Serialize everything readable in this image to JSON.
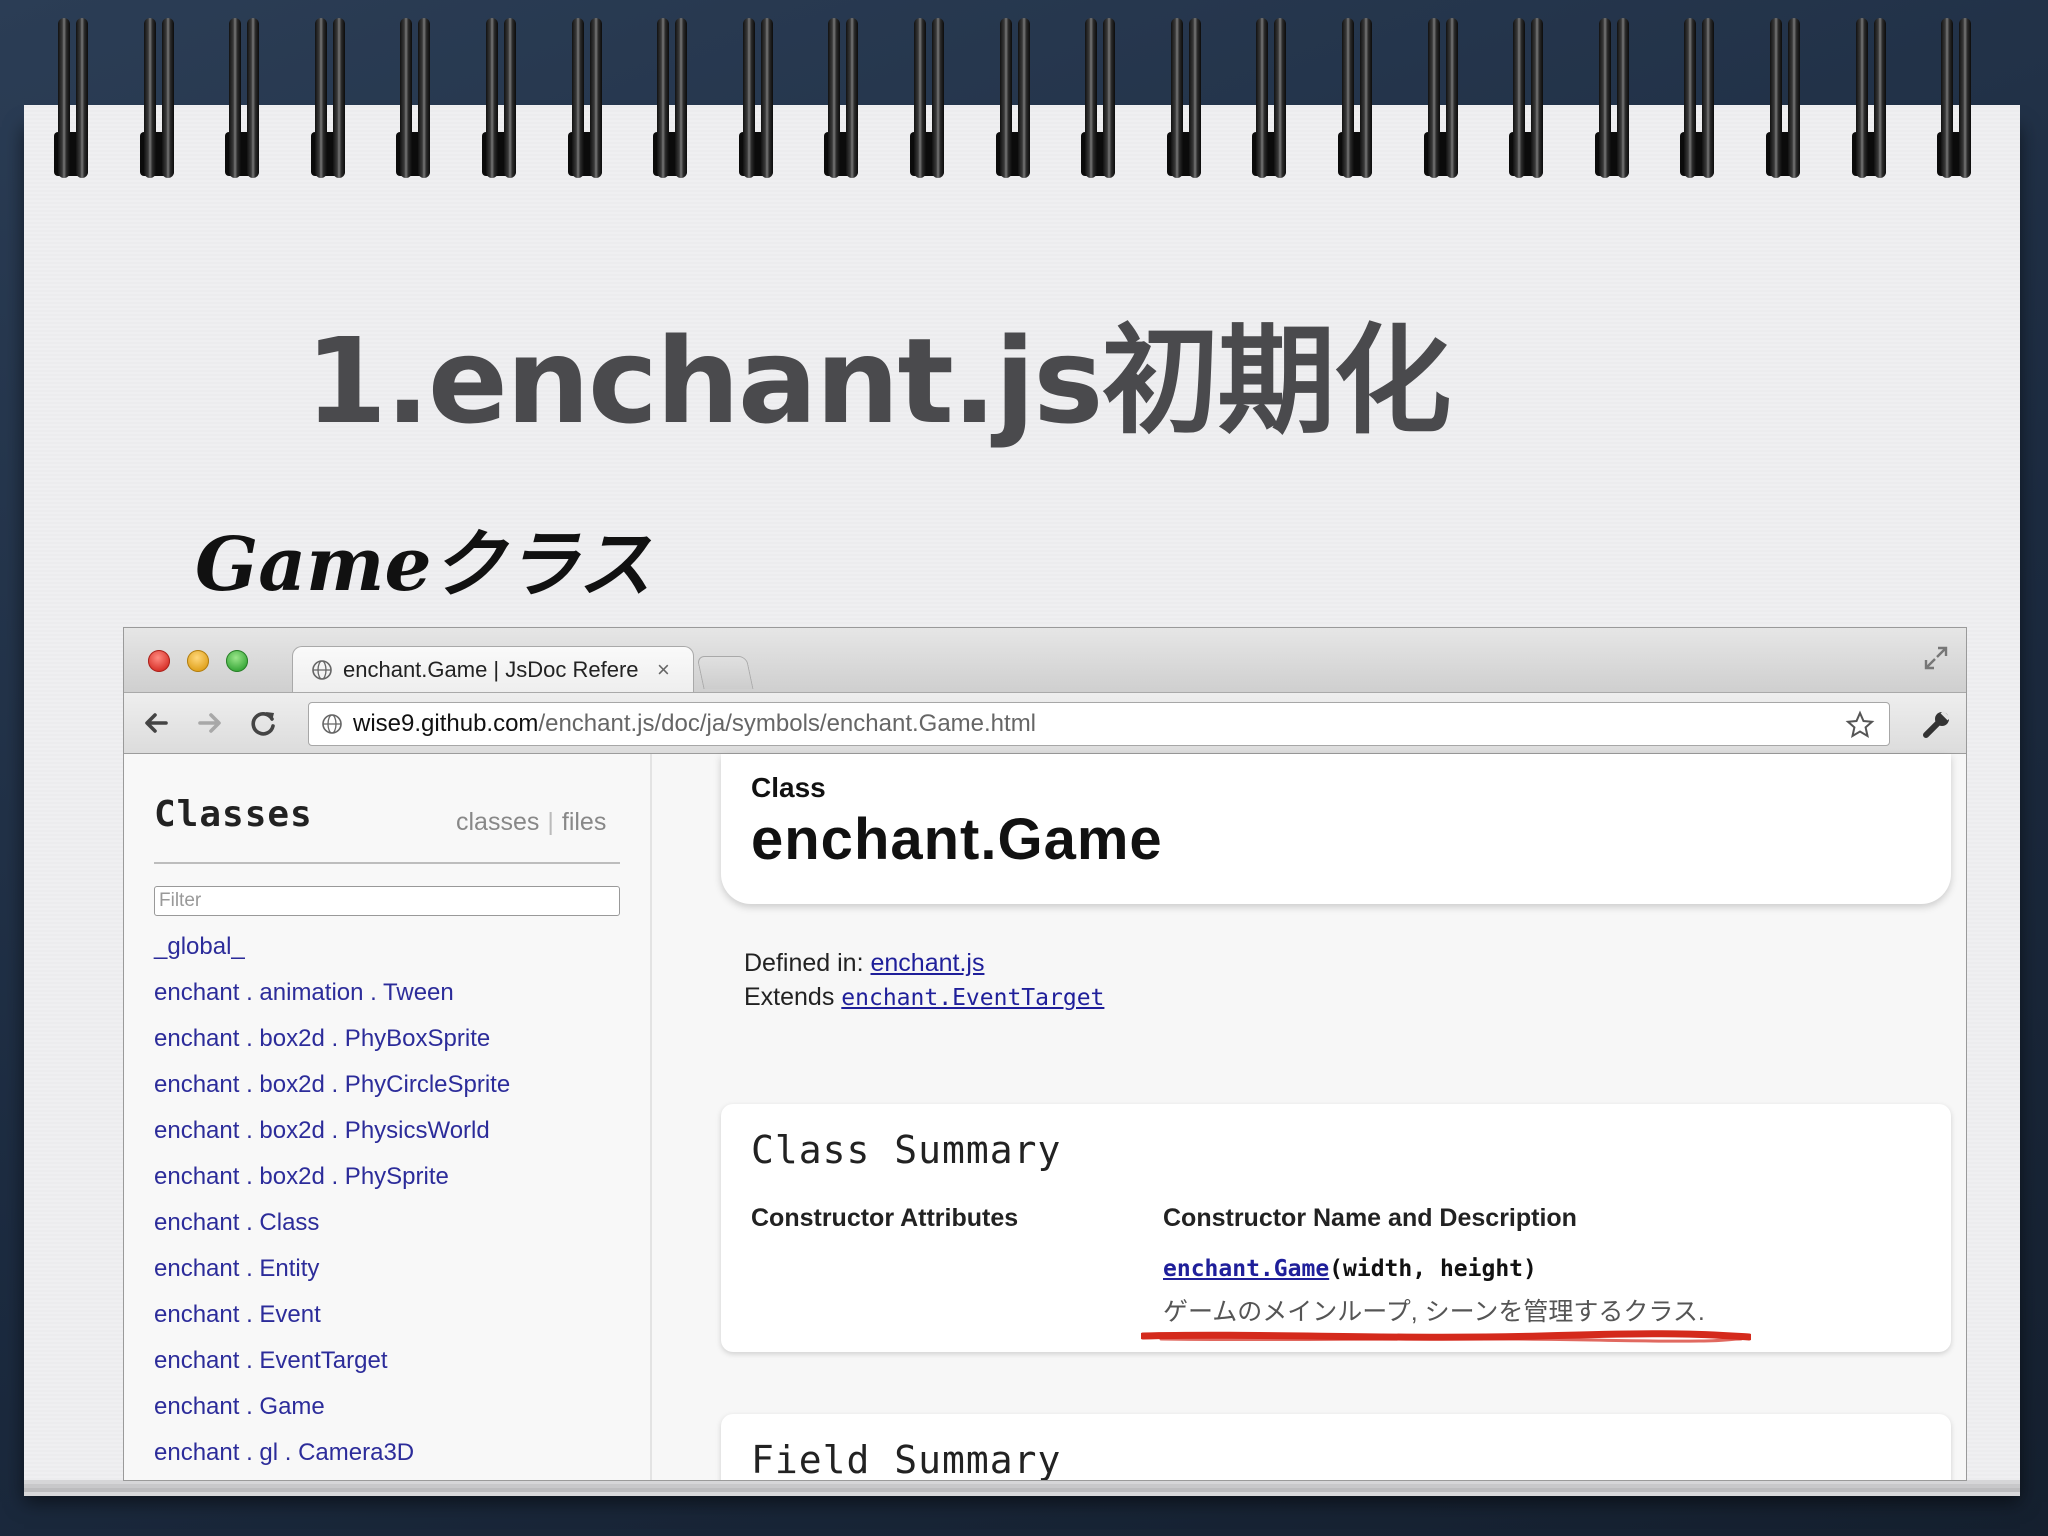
{
  "slide": {
    "title": "1.enchant.js初期化",
    "subtitle": "Gameクラス"
  },
  "browser": {
    "tab_title": "enchant.Game | JsDoc Refere",
    "tab_close": "×",
    "url_host": "wise9.github.com",
    "url_path": "/enchant.js/doc/ja/symbols/enchant.Game.html",
    "icons": {
      "back": "back-arrow-icon",
      "forward": "forward-arrow-icon",
      "reload": "reload-icon",
      "bookmark": "star-icon",
      "settings": "wrench-icon",
      "site": "globe-icon",
      "fullscreen": "fullscreen-icon"
    }
  },
  "sidebar": {
    "title": "Classes",
    "link_classes": "classes",
    "link_separator": "|",
    "link_files": "files",
    "filter_placeholder": "Filter",
    "items": [
      "_global_",
      "enchant . animation . Tween",
      "enchant . box2d . PhyBoxSprite",
      "enchant . box2d . PhyCircleSprite",
      "enchant . box2d . PhysicsWorld",
      "enchant . box2d . PhySprite",
      "enchant . Class",
      "enchant . Entity",
      "enchant . Event",
      "enchant . EventTarget",
      "enchant . Game",
      "enchant . gl . Camera3D"
    ]
  },
  "main": {
    "kind_label": "Class",
    "class_name": "enchant.Game",
    "defined_in_label": "Defined in:",
    "defined_in_file": "enchant.js",
    "extends_label": "Extends",
    "extends_class": "enchant.EventTarget",
    "class_summary": {
      "title": "Class Summary",
      "col_attributes": "Constructor Attributes",
      "col_name": "Constructor Name and Description",
      "constructor_link": "enchant.Game",
      "constructor_args": "(width, height)",
      "constructor_desc": "ゲームのメインループ, シーンを管理するクラス."
    },
    "field_summary": {
      "title": "Field Summary"
    }
  },
  "colors": {
    "link": "#1f1f9a",
    "underline_annotation": "#d42a1c",
    "slide_title": "#4a4a4d"
  }
}
